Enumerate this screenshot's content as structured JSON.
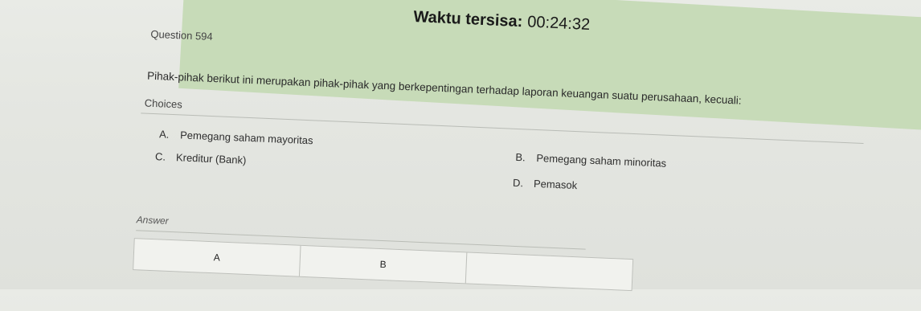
{
  "timer": {
    "label": "Waktu tersisa:",
    "value": "00:24:32"
  },
  "question": {
    "number": "Question 594",
    "text": "Pihak-pihak berikut ini merupakan pihak-pihak yang berkepentingan terhadap laporan keuangan suatu perusahaan, kecuali:"
  },
  "choices_label": "Choices",
  "choices": [
    {
      "letter": "A.",
      "text": "Pemegang saham mayoritas"
    },
    {
      "letter": "B.",
      "text": "Pemegang saham minoritas"
    },
    {
      "letter": "C.",
      "text": "Kreditur (Bank)"
    },
    {
      "letter": "D.",
      "text": "Pemasok"
    }
  ],
  "answer_label": "Answer",
  "answer_options": [
    "A",
    "B",
    ""
  ]
}
